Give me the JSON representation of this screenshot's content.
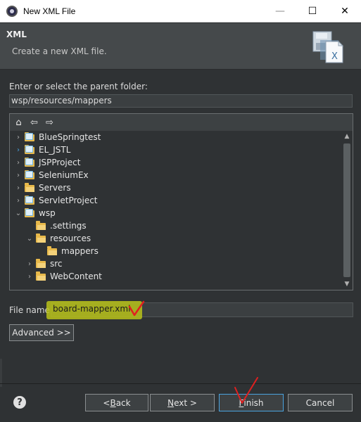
{
  "window": {
    "title": "New XML File",
    "minimize": "—",
    "maximize": "☐",
    "close": "✕"
  },
  "banner": {
    "title": "XML",
    "subtitle": "Create a new XML file."
  },
  "folder": {
    "label": "Enter or select the parent folder:",
    "value": "wsp/resources/mappers"
  },
  "tree": {
    "toolbar": [
      "home-icon",
      "back-icon",
      "forward-icon"
    ],
    "items": [
      {
        "label": "BlueSpringtest",
        "twisty": "›",
        "type": "project"
      },
      {
        "label": "EL_JSTL",
        "twisty": "›",
        "type": "project"
      },
      {
        "label": "JSPProject",
        "twisty": "›",
        "type": "project"
      },
      {
        "label": "SeleniumEx",
        "twisty": "›",
        "type": "project"
      },
      {
        "label": "Servers",
        "twisty": "›",
        "type": "folder"
      },
      {
        "label": "ServletProject",
        "twisty": "›",
        "type": "project"
      },
      {
        "label": "wsp",
        "twisty": "⌄",
        "type": "project"
      },
      {
        "label": ".settings",
        "twisty": "",
        "type": "folder"
      },
      {
        "label": "resources",
        "twisty": "⌄",
        "type": "folder"
      },
      {
        "label": "mappers",
        "twisty": "",
        "type": "folder"
      },
      {
        "label": "src",
        "twisty": "›",
        "type": "folder"
      },
      {
        "label": "WebContent",
        "twisty": "›",
        "type": "folder"
      }
    ]
  },
  "file_name": {
    "label": "File name:",
    "value": "board-mapper.xml"
  },
  "buttons": {
    "advanced": "Advanced >>",
    "back": "< Back",
    "next": "Next >",
    "finish": "Finish",
    "cancel": "Cancel",
    "help": "?"
  },
  "colors": {
    "background": "#2f3234",
    "highlight": "#b9c21a",
    "annotation_red": "#e02020",
    "focus": "#4aa3df"
  }
}
